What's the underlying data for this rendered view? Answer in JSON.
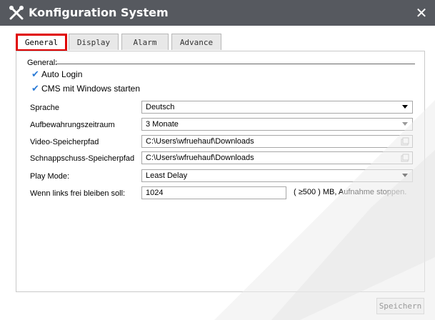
{
  "window": {
    "title": "Konfiguration System",
    "close_glyph": "✕"
  },
  "tabs": [
    {
      "label": "General",
      "active": true
    },
    {
      "label": "Display",
      "active": false
    },
    {
      "label": "Alarm",
      "active": false
    },
    {
      "label": "Advance",
      "active": false
    }
  ],
  "general": {
    "group_label": "General:",
    "auto_login": {
      "label": "Auto Login",
      "checked": true
    },
    "cms_start": {
      "label": "CMS mit Windows starten",
      "checked": true
    },
    "language": {
      "label": "Sprache",
      "value": "Deutsch"
    },
    "retention": {
      "label": "Aufbewahrungszeitraum",
      "value": "3 Monate"
    },
    "video_path": {
      "label": "Video-Speicherpfad",
      "value": "C:\\Users\\wfruehauf\\Downloads"
    },
    "snapshot_path": {
      "label": "Schnappschuss-Speicherpfad",
      "value": "C:\\Users\\wfruehauf\\Downloads"
    },
    "play_mode": {
      "label": "Play Mode:",
      "value": "Least Delay"
    },
    "free_space": {
      "label": "Wenn links frei bleiben soll:",
      "value": "1024",
      "unit": "( ≥500 ) MB, Aufnahme stoppen."
    }
  },
  "footer": {
    "save_label": "Speichern"
  },
  "colors": {
    "titlebar": "#56595f",
    "active_tab_border": "#e00000",
    "checkmark": "#2b7bd6"
  },
  "icons": {
    "app": "tools-icon",
    "close": "close-icon",
    "folder": "folder-icon",
    "check": "checkmark-icon",
    "dropdown": "chevron-down-icon"
  }
}
